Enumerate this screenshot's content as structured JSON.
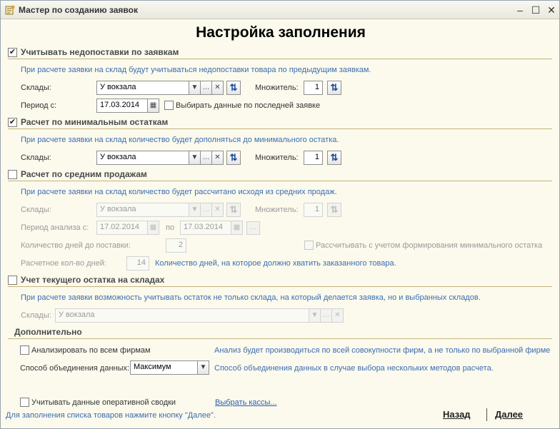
{
  "window": {
    "title": "Мастер по созданию заявок"
  },
  "page": {
    "heading": "Настройка заполнения"
  },
  "section_shortages": {
    "checked": true,
    "title": "Учитывать недопоставки по заявкам",
    "description": "При расчете заявки на склад будут учитываться недопоставки товара по предыдущим заявкам.",
    "warehouses_label": "Склады:",
    "warehouses_value": "У вокзала",
    "multiplier_label": "Множитель:",
    "multiplier_value": "1",
    "period_label": "Период с:",
    "period_value": "17.03.2014",
    "last_request_checked": false,
    "last_request_label": "Выбирать данные по последней заявке"
  },
  "section_min": {
    "checked": true,
    "title": "Расчет по минимальным остаткам",
    "description": "При расчете заявки на склад количество будет дополняться до минимального остатка.",
    "warehouses_label": "Склады:",
    "warehouses_value": "У вокзала",
    "multiplier_label": "Множитель:",
    "multiplier_value": "1"
  },
  "section_avg": {
    "checked": false,
    "title": "Расчет по средним продажам",
    "description": "При расчете заявки на склад количество будет рассчитано исходя из средних продаж.",
    "warehouses_label": "Склады:",
    "warehouses_value": "У вокзала",
    "multiplier_label": "Множитель:",
    "multiplier_value": "1",
    "period_label": "Период анализа с:",
    "period_from": "17.02.2014",
    "period_to_label": "по",
    "period_to": "17.03.2014",
    "days_label": "Количество дней до поставки:",
    "days_value": "2",
    "consider_min_checked": false,
    "consider_min_label": "Рассчитывать с учетом формирования минимального остатка",
    "calc_days_label": "Расчетное кол-во дней:",
    "calc_days_value": "14",
    "calc_days_note": "Количество дней, на которое должно хватить заказанного товара."
  },
  "section_stock": {
    "checked": false,
    "title": "Учет текущего остатка на складах",
    "description": "При расчете заявки возможность учитывать остаток не только склада, на который делается заявка, но и выбранных складов.",
    "warehouses_label": "Склады:",
    "warehouses_value": "У вокзала"
  },
  "section_extra": {
    "title": "Дополнительно",
    "all_firms_checked": false,
    "all_firms_label": "Анализировать по всем фирмам",
    "all_firms_note": "Анализ будет производиться по всей совокупности фирм, а не только по выбранной фирме",
    "combine_label": "Способ объединения данных:",
    "combine_value": "Максимум",
    "combine_note": "Способ объединения данных в случае выбора нескольких методов расчета.",
    "operative_checked": false,
    "operative_label": "Учитывать данные оперативной сводки",
    "cash_link": "Выбрать кассы..."
  },
  "footer": {
    "hint": "Для заполнения списка товаров нажмите кнопку \"Далее\".",
    "back_label": "Назад",
    "next_label": "Далее"
  },
  "colors": {
    "accent_text": "#3c6cb0",
    "section_line": "#c5b37c",
    "background": "#fbfaed"
  }
}
